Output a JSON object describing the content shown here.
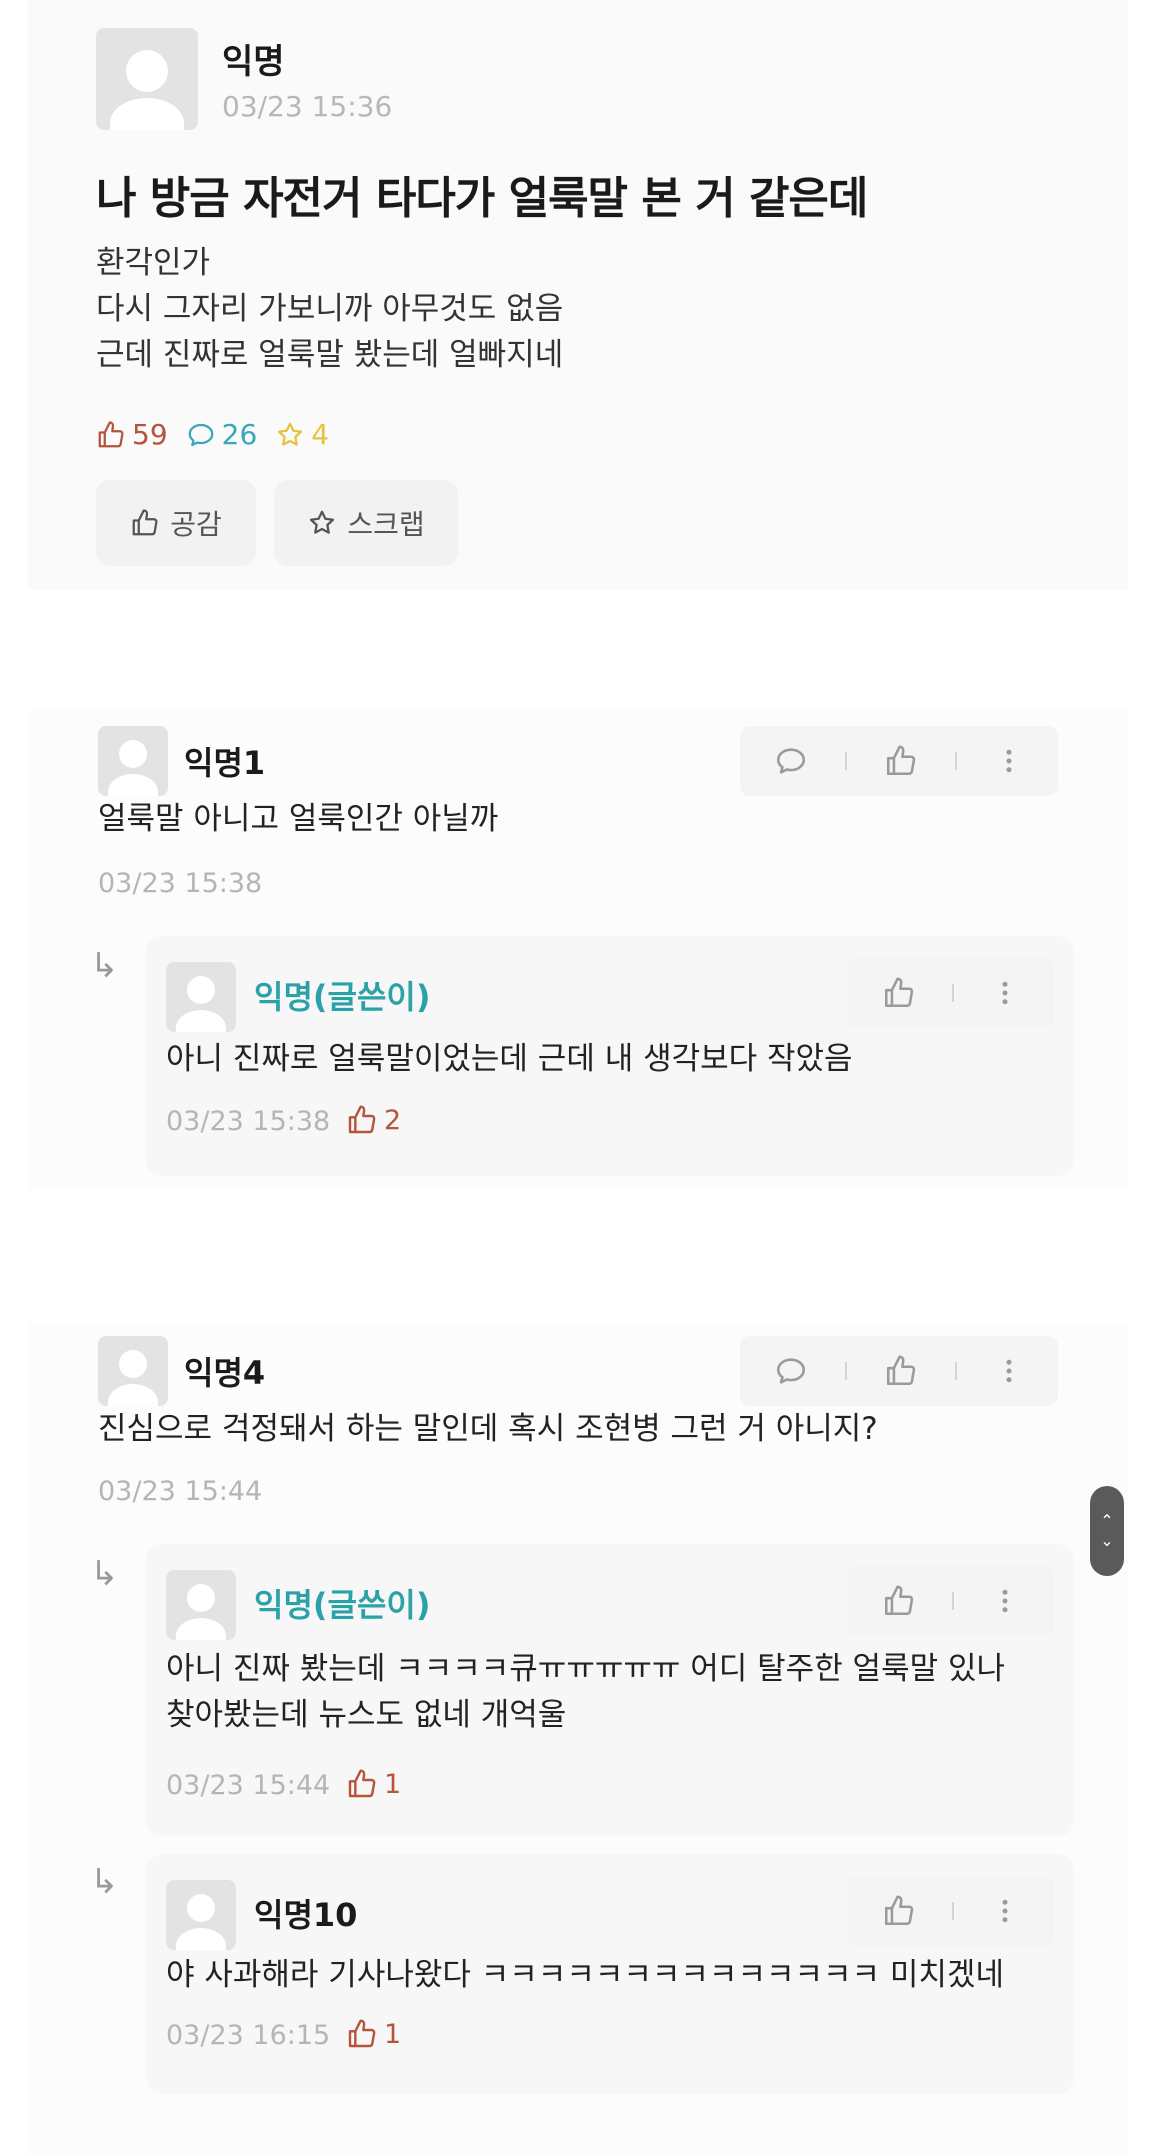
{
  "post": {
    "author": "익명",
    "date": "03/23 15:36",
    "title": "나 방금 자전거 타다가 얼룩말 본 거 같은데",
    "body": [
      "환각인가",
      "다시 그자리 가보니까 아무것도 없음",
      "근데 진짜로 얼룩말 봤는데 얼빠지네"
    ],
    "likes": "59",
    "comments": "26",
    "scraps": "4",
    "like_button": "공감",
    "scrap_button": "스크랩"
  },
  "comments": [
    {
      "author": "익명1",
      "text": "얼룩말 아니고 얼룩인간 아닐까",
      "date": "03/23 15:38",
      "reply": {
        "author": "익명(글쓴이)",
        "text": "아니 진짜로 얼룩말이었는데 근데 내 생각보다 작았음",
        "date": "03/23 15:38",
        "likes": "2"
      }
    },
    {
      "author": "익명4",
      "text": "진심으로 걱정돼서 하는 말인데 혹시 조현병 그런 거 아니지?",
      "date": "03/23 15:44",
      "replies": [
        {
          "author": "익명(글쓴이)",
          "text": [
            "아니 진짜 봤는데 ㅋㅋㅋㅋ큐ㅠㅠㅠㅠㅠ 어디 탈주한 얼룩말 있나",
            "찾아봤는데 뉴스도 없네 개억울"
          ],
          "date": "03/23 15:44",
          "likes": "1"
        },
        {
          "author": "익명10",
          "text": "야 사과해라 기사나왔다 ㅋㅋㅋㅋㅋㅋㅋㅋㅋㅋㅋㅋㅋㅋ 미치겠네",
          "date": "03/23 16:15",
          "likes": "1"
        }
      ]
    }
  ],
  "colors": {
    "like": "#b5533b",
    "comment": "#3aa6b9",
    "scrap": "#e6c33a",
    "op_name": "#2ba2a8"
  },
  "icons": [
    "thumbs-up-icon",
    "comment-bubble-icon",
    "star-icon",
    "more-vertical-icon",
    "reply-arrow-icon",
    "scroll-arrows-icon"
  ]
}
